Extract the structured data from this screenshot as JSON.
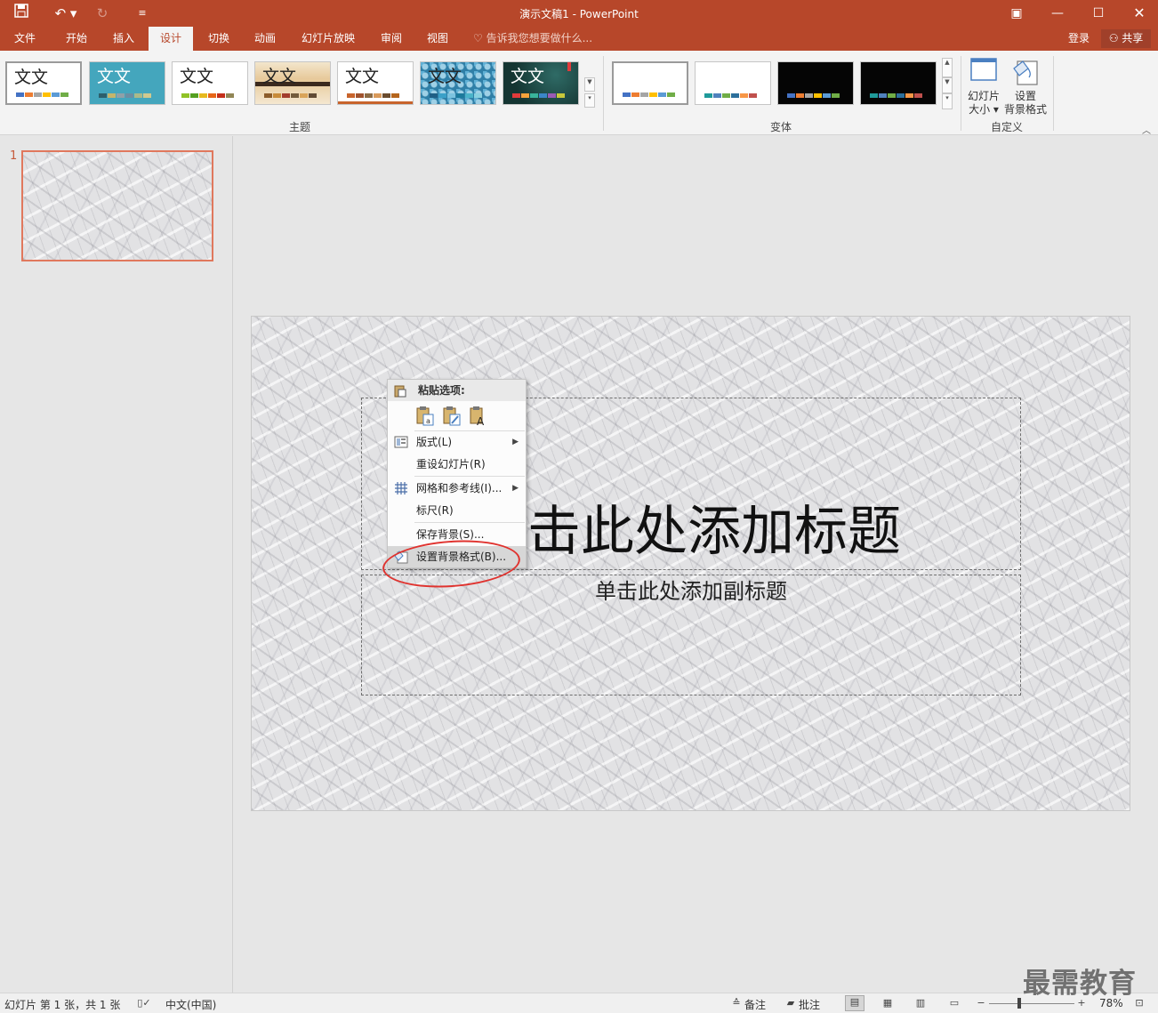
{
  "window": {
    "title": "演示文稿1 - PowerPoint"
  },
  "tabs": [
    "文件",
    "开始",
    "插入",
    "设计",
    "切换",
    "动画",
    "幻灯片放映",
    "审阅",
    "视图"
  ],
  "active_tab": "设计",
  "tell_me": "告诉我您想要做什么...",
  "account": {
    "login": "登录",
    "share": "共享"
  },
  "ribbon": {
    "themes_group": "主题",
    "variants_group": "变体",
    "customize_group": "自定义",
    "theme_sample": "文文",
    "slide_size": {
      "line1": "幻灯片",
      "line2": "大小"
    },
    "format_bg": {
      "line1": "设置",
      "line2": "背景格式"
    }
  },
  "colors": {
    "accent": "#b7472a",
    "highlight_circle": "#e0322e",
    "thumb_border": "#e0785d"
  },
  "thumbnails": [
    {
      "number": "1"
    }
  ],
  "slide": {
    "title": "单击此处添加标题",
    "title_visible": "击此处添加标题",
    "subtitle": "单击此处添加副标题"
  },
  "context_menu": {
    "header": "粘贴选项:",
    "paste_icons": [
      "paste-use-destination-theme-icon",
      "paste-keep-source-formatting-icon",
      "paste-keep-text-only-icon"
    ],
    "items": [
      {
        "label": "版式(L)",
        "has_submenu": true,
        "icon": "layout-icon"
      },
      {
        "label": "重设幻灯片(R)",
        "has_submenu": false
      },
      {
        "label": "网格和参考线(I)...",
        "has_submenu": true,
        "icon": "grid-icon"
      },
      {
        "label": "标尺(R)",
        "has_submenu": false
      },
      {
        "label": "保存背景(S)...",
        "has_submenu": false
      },
      {
        "label": "设置背景格式(B)...",
        "has_submenu": false,
        "icon": "format-background-icon",
        "highlighted": true
      }
    ]
  },
  "status": {
    "slide_info": "幻灯片 第 1 张，共 1 张",
    "language": "中文(中国)",
    "notes": "备注",
    "comments": "批注",
    "zoom": "78%"
  },
  "watermark": "最需教育"
}
